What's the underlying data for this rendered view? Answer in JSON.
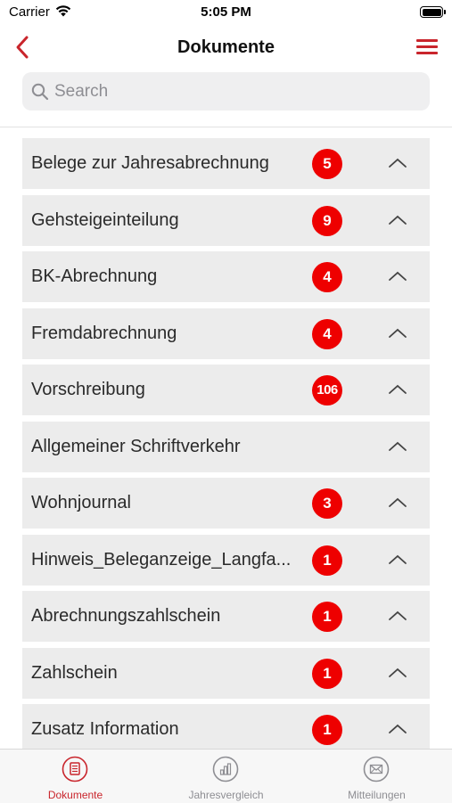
{
  "status_bar": {
    "carrier": "Carrier",
    "time": "5:05 PM"
  },
  "nav": {
    "title": "Dokumente",
    "back_icon": "chevron-left-icon",
    "menu_icon": "hamburger-menu-icon"
  },
  "search": {
    "placeholder": "Search",
    "value": ""
  },
  "colors": {
    "accent": "#c9252c",
    "badge": "#ee0000",
    "row_bg": "#ececec"
  },
  "documents": [
    {
      "label": "Belege zur Jahresabrechnung",
      "count": "5"
    },
    {
      "label": "Gehsteigeinteilung",
      "count": "9"
    },
    {
      "label": "BK-Abrechnung",
      "count": "4"
    },
    {
      "label": "Fremdabrechnung",
      "count": "4"
    },
    {
      "label": "Vorschreibung",
      "count": "106"
    },
    {
      "label": "Allgemeiner Schriftverkehr",
      "count": ""
    },
    {
      "label": "Wohnjournal",
      "count": "3"
    },
    {
      "label": "Hinweis_Beleganzeige_Langfa...",
      "count": "1"
    },
    {
      "label": "Abrechnungszahlschein",
      "count": "1"
    },
    {
      "label": "Zahlschein",
      "count": "1"
    },
    {
      "label": "Zusatz Information",
      "count": "1"
    }
  ],
  "tabbar": {
    "tabs": [
      {
        "label": "Dokumente",
        "icon": "document-icon",
        "active": true
      },
      {
        "label": "Jahresvergleich",
        "icon": "bar-chart-icon",
        "active": false
      },
      {
        "label": "Mitteilungen",
        "icon": "envelope-icon",
        "active": false
      }
    ]
  }
}
